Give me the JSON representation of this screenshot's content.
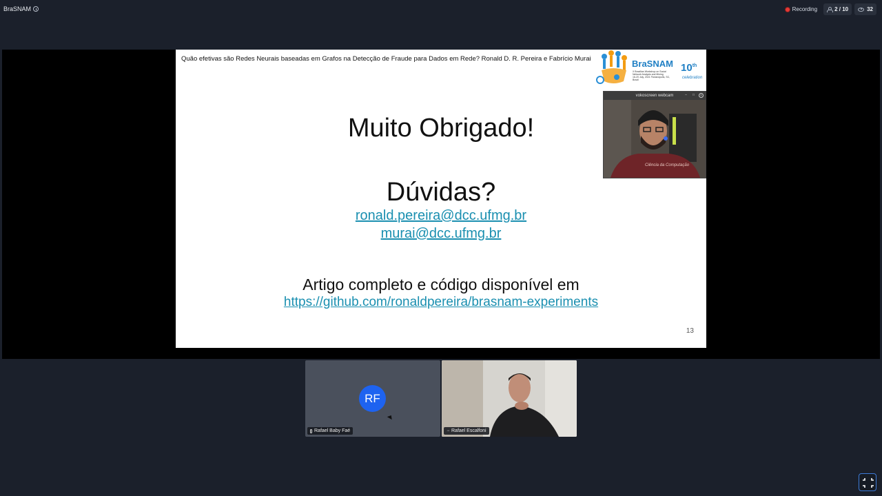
{
  "topbar": {
    "room_name": "BraSNAM",
    "recording_label": "Recording",
    "participants": "2 / 10",
    "viewers": "32"
  },
  "slide": {
    "header": "Quão efetivas são Redes Neurais baseadas em Grafos na Detecção de Fraude para Dados em Rede? Ronald D. R. Pereira e Fabrício Murai",
    "title": "Muito Obrigado!",
    "questions": "Dúvidas?",
    "email1": "ronald.pereira@dcc.ufmg.br",
    "email2": "murai@dcc.ufmg.br",
    "article_text": "Artigo completo e código disponível em",
    "github_link": "https://github.com/ronaldpereira/brasnam-experiments",
    "page_number": "13",
    "logo": {
      "name": "BraSNAM",
      "subtitle": "X Brazilian Workshop on Social Network Analysis and Mining",
      "date": "16-20 July, 2021 Florianópolis, SC, Brazil",
      "tenth": "10",
      "tenth_suffix": "th",
      "celebration": "celebration"
    }
  },
  "webcam_window": {
    "title": "vokoscreen webcam",
    "shirt_text": "Ciência da Computação"
  },
  "participants": [
    {
      "initials": "RF",
      "name": "Rafael Baby Faé"
    },
    {
      "name": "Rafael Escalfoni"
    }
  ],
  "colors": {
    "background": "#1b202b",
    "link": "#1a8fb0",
    "avatar": "#1e63f0",
    "recording": "#e53935"
  }
}
